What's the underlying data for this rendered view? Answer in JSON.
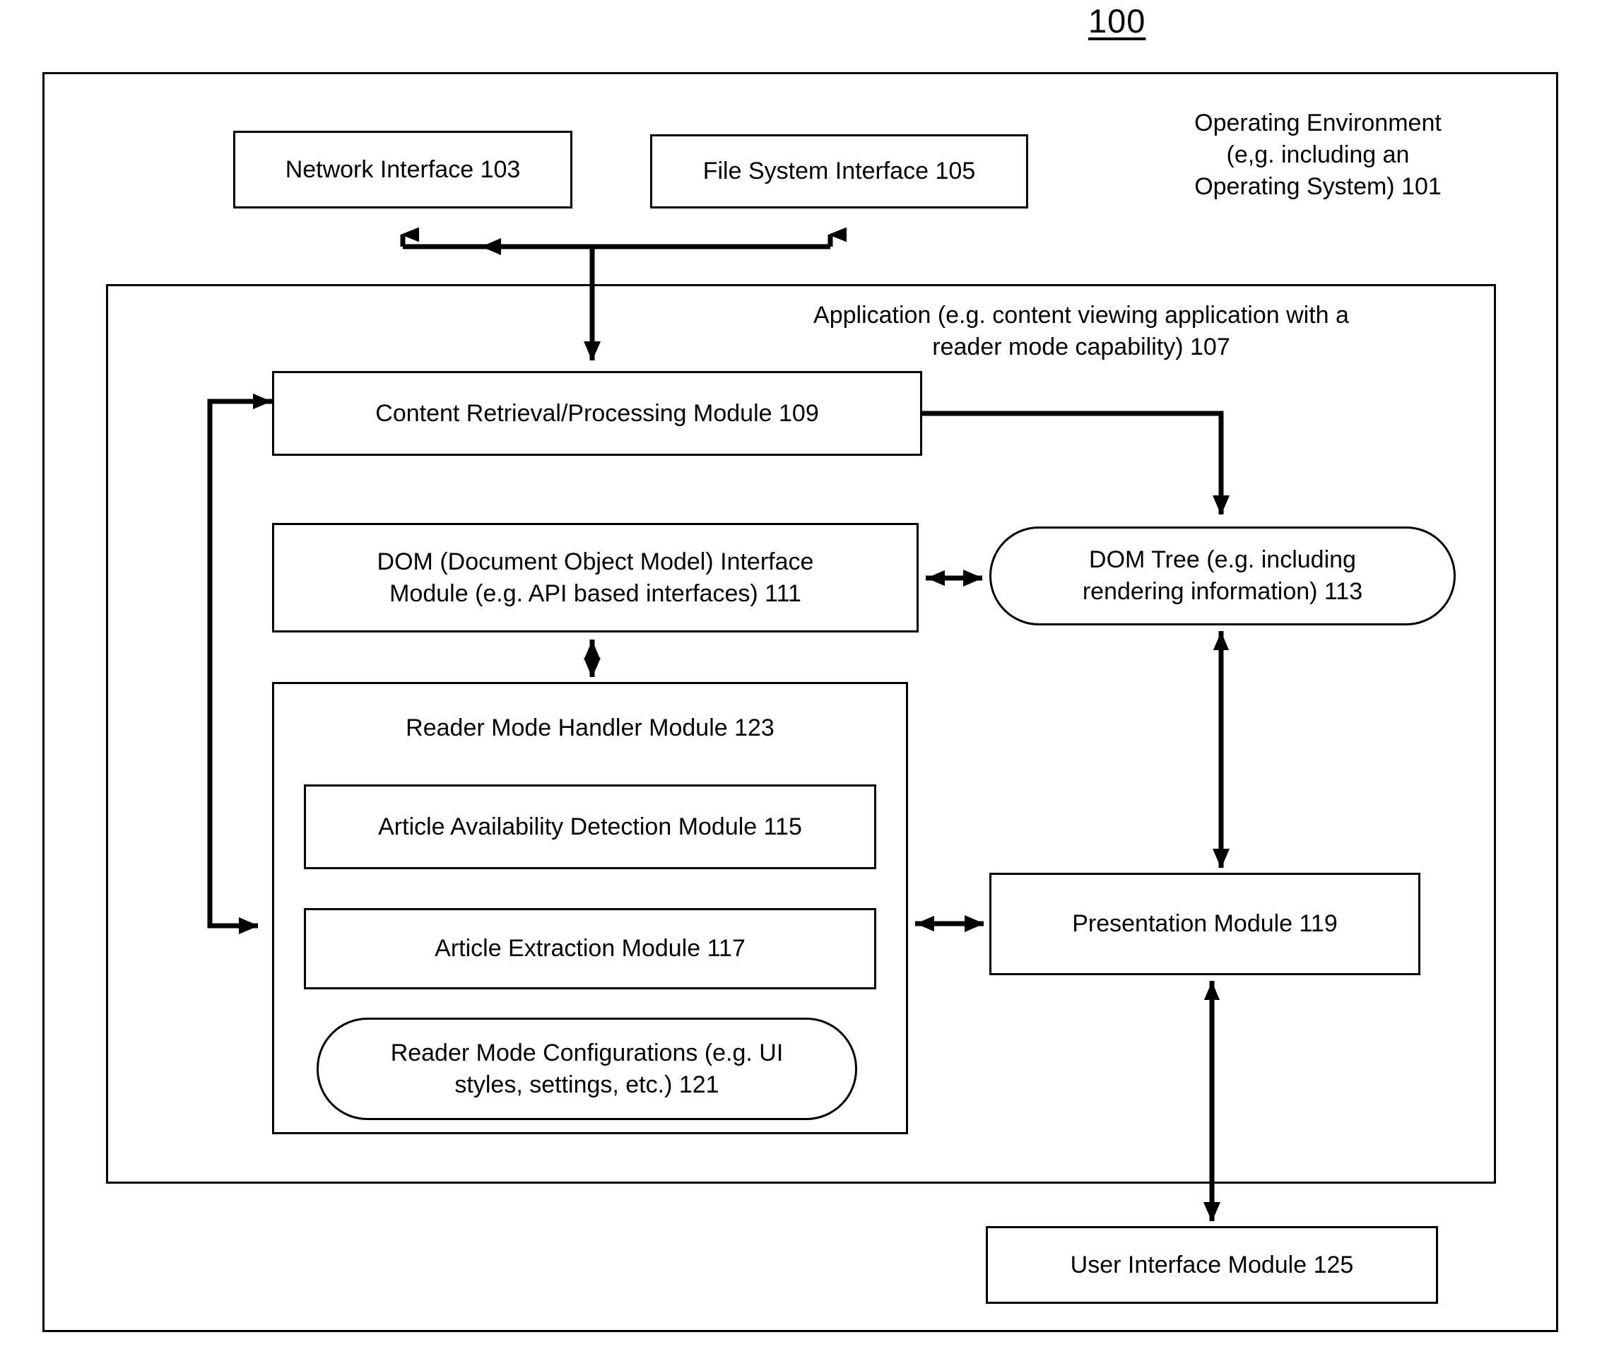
{
  "figure": {
    "number": "100"
  },
  "outer": {
    "label": "Operating Environment\n(e,g. including an\nOperating System)  101"
  },
  "application": {
    "label": "Application (e.g. content viewing application with a\nreader mode capability) 107"
  },
  "boxes": {
    "network_interface": "Network Interface 103",
    "file_system_interface": "File System Interface 105",
    "content_retrieval": "Content Retrieval/Processing  Module 109",
    "dom_interface": "DOM (Document Object Model) Interface\nModule (e.g. API based interfaces) 111",
    "dom_tree": "DOM Tree (e.g. including\nrendering information) 113",
    "reader_mode_handler": "Reader Mode Handler Module 123",
    "article_availability": "Article Availability Detection Module 115",
    "article_extraction": "Article Extraction Module 117",
    "reader_mode_configurations": "Reader Mode Configurations (e.g. UI\nstyles, settings, etc.) 121",
    "presentation": "Presentation Module  119",
    "user_interface": "User Interface Module 125"
  },
  "colors": {
    "stroke": "#000000",
    "background": "#ffffff"
  }
}
